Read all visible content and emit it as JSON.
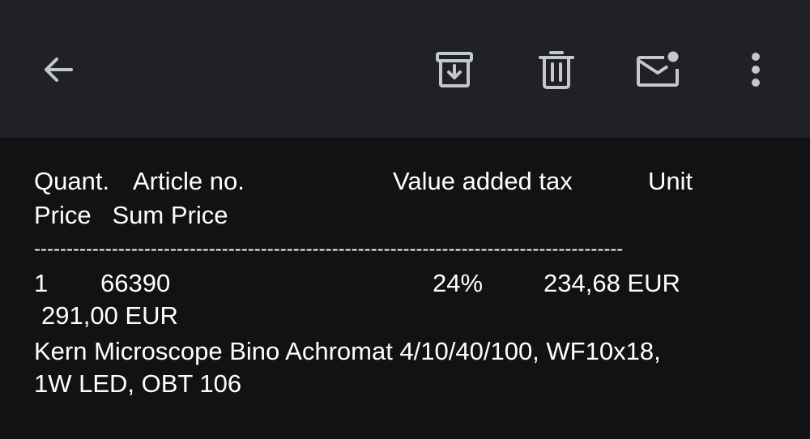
{
  "toolbar": {
    "back_icon": "arrow-left-icon",
    "archive_icon": "archive-icon",
    "delete_icon": "trash-icon",
    "mark_unread_icon": "mail-unread-icon",
    "more_icon": "more-vertical-icon"
  },
  "message": {
    "header_line1": {
      "quant": "Quant.",
      "article_no": "Article no.",
      "vat": "Value added tax",
      "unit": "Unit"
    },
    "header_line2": "Price   Sum Price",
    "separator": "-------------------------------------------------------------------------------------------",
    "row": {
      "quant": "1",
      "article_no": "66390",
      "vat": "24%",
      "unit_price": "234,68 EUR",
      "sum_price": "291,00 EUR"
    },
    "description_line1": "Kern Microscope Bino Achromat 4/10/40/100, WF10x18,",
    "description_line2": "1W LED, OBT 106"
  },
  "colors": {
    "toolbar_bg": "#202125",
    "content_bg": "#121214",
    "icon": "#c4c7cc",
    "text": "#ffffff"
  }
}
